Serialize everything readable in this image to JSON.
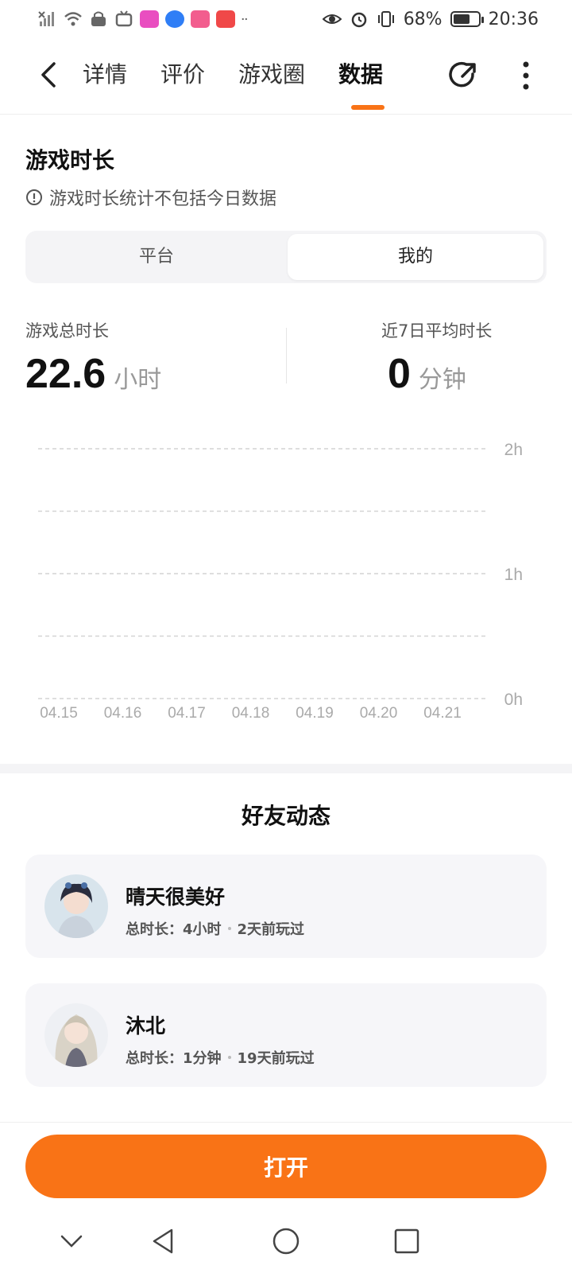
{
  "status_bar": {
    "battery": "68%",
    "time": "20:36",
    "battery_level": 0.68,
    "icons": [
      "signal-off-icon",
      "wifi-icon",
      "vpn-icon",
      "tv-icon",
      "video-app-icon",
      "browser-app-icon",
      "bilibili-app-icon",
      "shopping-app-icon",
      "more-dots-icon",
      "eye-icon",
      "alarm-icon",
      "vibrate-icon",
      "leaf-battery-icon"
    ]
  },
  "nav": {
    "tabs": [
      "详情",
      "评价",
      "游戏圈",
      "数据"
    ],
    "active_tab": "数据"
  },
  "play_time": {
    "title": "游戏时长",
    "note": "游戏时长统计不包括今日数据",
    "segments": [
      "平台",
      "我的"
    ],
    "active_segment": "我的",
    "total_label": "游戏总时长",
    "total_value": "22.6",
    "total_unit": "小时",
    "avg_label": "近7日平均时长",
    "avg_value": "0",
    "avg_unit": "分钟"
  },
  "chart_data": {
    "type": "bar",
    "categories": [
      "04.15",
      "04.16",
      "04.17",
      "04.18",
      "04.19",
      "04.20",
      "04.21"
    ],
    "values": [
      0,
      0,
      0,
      0,
      0,
      0,
      0
    ],
    "y_ticks": [
      "2h",
      "1h",
      "0h"
    ],
    "ylim": [
      0,
      2
    ],
    "grid": true
  },
  "friends": {
    "title": "好友动态",
    "items": [
      {
        "name": "晴天很美好",
        "duration": "总时长：4小时",
        "last_played": "2天前玩过"
      },
      {
        "name": "沐北",
        "duration": "总时长：1分钟",
        "last_played": "19天前玩过"
      }
    ]
  },
  "open_button": "打开",
  "colors": {
    "accent": "#f97316",
    "card_bg": "#f6f6f9"
  }
}
